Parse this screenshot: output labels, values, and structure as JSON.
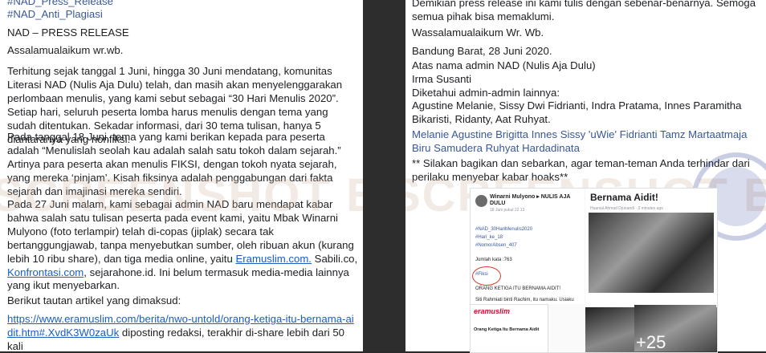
{
  "left": {
    "hashtags": [
      "#NAD_Press_Release",
      "#NAD_Anti_Plagiasi"
    ],
    "title": "NAD – PRESS RELEASE",
    "greeting": "Assalamualaikum wr.wb.",
    "para1": "Terhitung sejak tanggal 1 Juni, hingga 30 Juni mendatang, komunitas Literasi NAD (Nulis Aja Dulu) telah, dan masih akan menyelenggarakan perlombaan menulis, yang kami sebut sebagai “30 Hari Menulis 2020”. Setiap hari, seluruh peserta lomba harus menulis dengan tema yang sudah ditentukan. Sekadar informasi, dari 30 tema tulisan, hanya 5 diantaranya yang nonfiksi.",
    "para2": "Pada tanggal 18 Juni, tema yang kami berikan kepada para peserta adalah “Menulislah seolah kau adalah salah satu tokoh dalam sejarah.” Artinya para peserta akan menulis FIKSI, dengan tokoh nyata sejarah, yang mereka ‘pinjam’. Kisah fiksinya adalah penggabungan dari fakta sejarah dan imajinasi mereka sendiri.",
    "para3_a": "Pada 27 Juni malam, kami sebagai admin NAD baru mendapat kabar bahwa salah satu tulisan peserta pada event kami, yaitu Mbak Winarni Mulyono (foto terlampir) telah di-copas (jiplak) secara tak bertanggungjawab, tanpa menyebutkan sumber, oleh ribuan akun (kurang lebih 10 ribu share), dan tiga media online, yaitu ",
    "link_eramuslim": "Eramuslim.com.",
    "para3_b": " Sabili.co, ",
    "link_konfrontasi": "Konfrontasi.com",
    "para3_c": ", sejarahone.id. Ini belum termasuk media-media lainnya yang ikut menyebarkan.",
    "para4": "Berikut tautan artikel yang dimaksud:",
    "article_link": "https://www.eramuslim.com/berita/nwo-untold/orang-ketiga-itu-bernama-aidit.htm#.XvdK3W0zaUk",
    "para5": " diposting redaksi, terakhir di-share lebih dari 50 kali"
  },
  "right": {
    "top_partial": "Demikian press release ini kami tulis dengan sebenar-benarnya. Semoga semua pihak bisa memaklumi.",
    "closing": "Wassalamualaikum Wr. Wb.",
    "place_date": "Bandung Barat, 28 Juni 2020.",
    "on_behalf": "Atas nama admin NAD (Nulis Aja Dulu)",
    "name": "Irma Susanti",
    "known_by": "Diketahui admin-admin lainnya:",
    "admins": "Agustine Melanie, Sissy Dwi Fidrianti, Indra Pratama, Innes Paramitha Bikaristi, Ridanty, Aat Ruhyat.",
    "tags": "Melanie Agustine Brigitta Innes Sissy 'uWie' Fidrianti Tamz Martaatmaja Biru Samudera Ruhyat Hardadinata",
    "note": "** Silakan bagikan dan sebarkan, agar teman-teman Anda terhindar dari perilaku menyebar kabar hoaks**"
  },
  "collage": {
    "post_author": "Winarni Mulyono ▸ NULIS AJA DULU",
    "post_time": "18 Juni pukul 22.13 ·",
    "post_tags": [
      "#NAD_30HariMenulis2020",
      "#Hari_ke_18",
      "#NomorAbsen_407"
    ],
    "word_count": "Jumlah kata :763",
    "fiksi_tag": "#Fiksi",
    "story_title": "ORANG KETIGA ITU BERNAMA AIDIT!",
    "story_start": "Siti Rahmiati binti Rachim, itu namaku. Usiaku",
    "right_title": "Bernama Aidit!",
    "right_meta": "Huanial Ahmad Djunandi · 3 minutes ago",
    "era_logo": "eramuslim",
    "era_head": "Orang Ketiga Itu Bernama Aidit",
    "more_count": "+25"
  },
  "watermark": "SCREENSHOT BY",
  "colors": {
    "link": "#1a5ec4",
    "hashtag": "#385898",
    "text": "#1c1e21"
  }
}
